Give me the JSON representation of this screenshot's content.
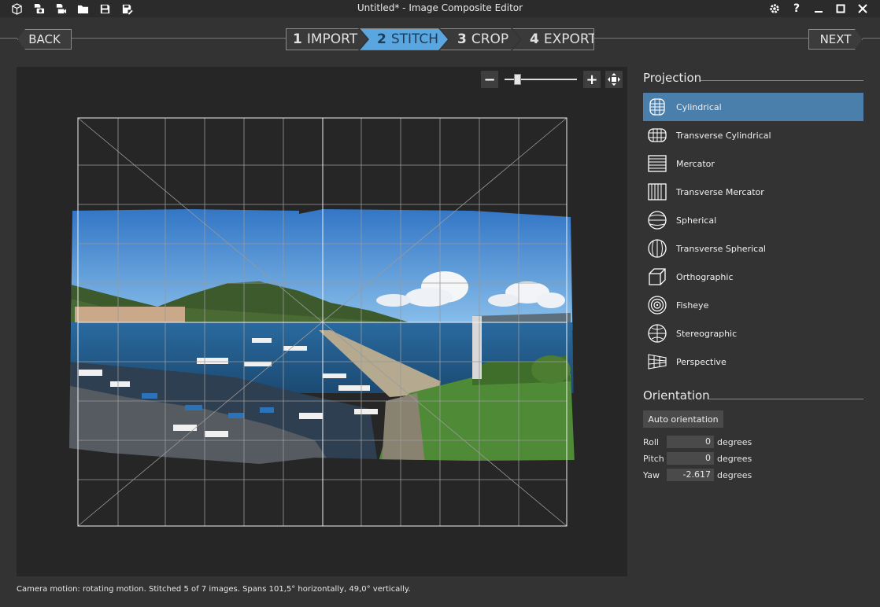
{
  "window": {
    "title": "Untitled* - Image Composite Editor",
    "toolbar_icons": [
      "new-project-icon",
      "new-panorama-from-images-icon",
      "new-panorama-from-video-icon",
      "open-icon",
      "save-icon",
      "save-as-icon"
    ],
    "controls": [
      "settings-icon",
      "help-icon",
      "minimize-icon",
      "maximize-icon",
      "close-icon"
    ]
  },
  "nav": {
    "back_label": "BACK",
    "next_label": "NEXT",
    "steps": [
      {
        "num": "1",
        "label": "IMPORT"
      },
      {
        "num": "2",
        "label": "STITCH"
      },
      {
        "num": "3",
        "label": "CROP"
      },
      {
        "num": "4",
        "label": "EXPORT"
      }
    ],
    "active_step": 2,
    "accent_color": "#5aa6e0"
  },
  "zoom": {
    "minus_label": "−",
    "plus_label": "+",
    "level_fraction": 0.15
  },
  "projection": {
    "title": "Projection",
    "items": [
      {
        "label": "Cylindrical",
        "icon": "cylindrical-icon",
        "selected": true
      },
      {
        "label": "Transverse Cylindrical",
        "icon": "transverse-cylindrical-icon"
      },
      {
        "label": "Mercator",
        "icon": "mercator-icon"
      },
      {
        "label": "Transverse Mercator",
        "icon": "transverse-mercator-icon"
      },
      {
        "label": "Spherical",
        "icon": "spherical-icon"
      },
      {
        "label": "Transverse Spherical",
        "icon": "transverse-spherical-icon"
      },
      {
        "label": "Orthographic",
        "icon": "orthographic-icon"
      },
      {
        "label": "Fisheye",
        "icon": "fisheye-icon"
      },
      {
        "label": "Stereographic",
        "icon": "stereographic-icon"
      },
      {
        "label": "Perspective",
        "icon": "perspective-icon"
      }
    ],
    "selected_color": "#4a7eab"
  },
  "orientation": {
    "title": "Orientation",
    "auto_label": "Auto orientation",
    "rows": [
      {
        "label": "Roll",
        "value": "0",
        "unit": "degrees"
      },
      {
        "label": "Pitch",
        "value": "0",
        "unit": "degrees"
      },
      {
        "label": "Yaw",
        "value": "-2.617",
        "unit": "degrees"
      }
    ]
  },
  "status": "Camera motion: rotating motion. Stitched 5 of 7 images. Spans 101,5° horizontally, 49,0° vertically."
}
